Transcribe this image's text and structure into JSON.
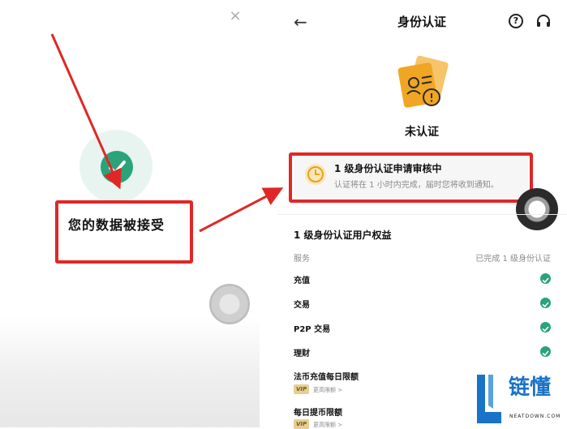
{
  "left_screen": {
    "close_label": "×",
    "accepted_text": "您的数据被接受"
  },
  "right_screen": {
    "header": {
      "back_label": "←",
      "title": "身份认证",
      "help_label": "?"
    },
    "status_label": "未认证",
    "review_card": {
      "title": "1 级身份认证申请审核中",
      "subtitle": "认证将在 1 小时内完成，届时您将收到通知。"
    },
    "benefits": {
      "title": "1 级身份认证用户权益",
      "col_service": "服务",
      "col_completed": "已完成 1 级身份认证",
      "rows": [
        {
          "label": "充值"
        },
        {
          "label": "交易"
        },
        {
          "label": "P2P 交易"
        },
        {
          "label": "理财"
        }
      ],
      "limit_rows": [
        {
          "label": "法币充值每日限额",
          "vip": "VIP",
          "more": "更高限额 >"
        },
        {
          "label": "每日提币限额",
          "vip": "VIP",
          "more": "更高限额 >"
        }
      ]
    }
  },
  "watermark": {
    "text": "链懂",
    "sub": "NEATDOWN.COM"
  },
  "colors": {
    "accent_green": "#2aa37a",
    "highlight_red": "#e02727",
    "illustration_orange": "#f0a623",
    "watermark_blue": "#1a73c6"
  }
}
